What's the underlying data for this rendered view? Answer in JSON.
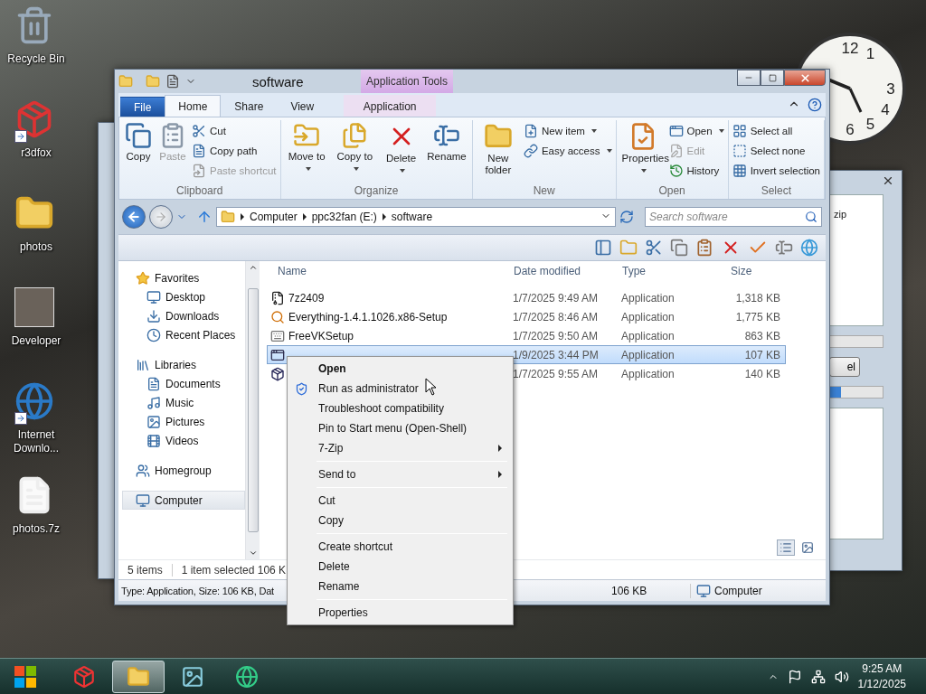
{
  "desktop_icons": [
    {
      "label": "Recycle Bin",
      "shortcut": false
    },
    {
      "label": "r3dfox",
      "shortcut": true
    },
    {
      "label": "photos",
      "shortcut": false
    },
    {
      "label": "Developer",
      "shortcut": false
    },
    {
      "label": "Internet Downlo...",
      "shortcut": true
    },
    {
      "label": "photos.7z",
      "shortcut": false
    }
  ],
  "clock": {
    "numerals": [
      "12",
      "1",
      "3",
      "4",
      "6",
      "5"
    ]
  },
  "back_window": {
    "list_text": "zip",
    "button": "el",
    "progress": [
      {
        "level": 0
      },
      {
        "level": 0.2
      }
    ]
  },
  "window": {
    "title": "software",
    "context_tab_header": "Application Tools"
  },
  "ribbon_tabs": [
    {
      "label": "File",
      "kind": "file",
      "selected": false
    },
    {
      "label": "Home",
      "kind": "tab",
      "selected": true
    },
    {
      "label": "Share",
      "kind": "tab",
      "selected": false
    },
    {
      "label": "View",
      "kind": "tab",
      "selected": false
    },
    {
      "label": "Application",
      "kind": "context",
      "selected": false
    }
  ],
  "ribbon_groups": [
    {
      "label": "Clipboard",
      "buttons": [
        {
          "label": "Copy",
          "kind": "large",
          "disabled": false,
          "dropdown": false
        },
        {
          "label": "Paste",
          "kind": "large",
          "disabled": true,
          "dropdown": false
        },
        {
          "label": "Cut",
          "kind": "small",
          "disabled": false,
          "dropdown": false
        },
        {
          "label": "Copy path",
          "kind": "small",
          "disabled": false,
          "dropdown": false
        },
        {
          "label": "Paste shortcut",
          "kind": "small",
          "disabled": true,
          "dropdown": false
        }
      ]
    },
    {
      "label": "Organize",
      "buttons": [
        {
          "label": "Move to",
          "kind": "large",
          "disabled": false,
          "dropdown": true
        },
        {
          "label": "Copy to",
          "kind": "large",
          "disabled": false,
          "dropdown": true
        },
        {
          "label": "Delete",
          "kind": "large",
          "disabled": false,
          "dropdown": true
        },
        {
          "label": "Rename",
          "kind": "large",
          "disabled": false,
          "dropdown": false
        }
      ]
    },
    {
      "label": "New",
      "buttons": [
        {
          "label": "New folder",
          "kind": "large",
          "disabled": false,
          "dropdown": false
        },
        {
          "label": "New item",
          "kind": "small",
          "disabled": false,
          "dropdown": true
        },
        {
          "label": "Easy access",
          "kind": "small",
          "disabled": false,
          "dropdown": true
        }
      ]
    },
    {
      "label": "Open",
      "buttons": [
        {
          "label": "Properties",
          "kind": "large",
          "disabled": false,
          "dropdown": true
        },
        {
          "label": "Open",
          "kind": "small",
          "disabled": false,
          "dropdown": true
        },
        {
          "label": "Edit",
          "kind": "small",
          "disabled": true,
          "dropdown": false
        },
        {
          "label": "History",
          "kind": "small",
          "disabled": false,
          "dropdown": false
        }
      ]
    },
    {
      "label": "Select",
      "buttons": [
        {
          "label": "Select all",
          "kind": "small",
          "disabled": false,
          "dropdown": false
        },
        {
          "label": "Select none",
          "kind": "small",
          "disabled": false,
          "dropdown": false
        },
        {
          "label": "Invert selection",
          "kind": "small",
          "disabled": false,
          "dropdown": false
        }
      ]
    }
  ],
  "address": {
    "crumbs": [
      "Computer",
      "ppc32fan (E:)",
      "software"
    ]
  },
  "search": {
    "placeholder": "Search software"
  },
  "navigation": [
    {
      "label": "Favorites",
      "selected": false,
      "children": [
        {
          "label": "Desktop",
          "selected": false
        },
        {
          "label": "Downloads",
          "selected": false
        },
        {
          "label": "Recent Places",
          "selected": false
        }
      ]
    },
    {
      "label": "Libraries",
      "selected": false,
      "children": [
        {
          "label": "Documents",
          "selected": false
        },
        {
          "label": "Music",
          "selected": false
        },
        {
          "label": "Pictures",
          "selected": false
        },
        {
          "label": "Videos",
          "selected": false
        }
      ]
    },
    {
      "label": "Homegroup",
      "selected": false
    },
    {
      "label": "Computer",
      "selected": true
    }
  ],
  "columns": [
    "Name",
    "Date modified",
    "Type",
    "Size"
  ],
  "files": [
    {
      "name": "7z2409",
      "date": "1/7/2025 9:49 AM",
      "type": "Application",
      "size": "1,318 KB",
      "selected": false
    },
    {
      "name": "Everything-1.4.1.1026.x86-Setup",
      "date": "1/7/2025 8:46 AM",
      "type": "Application",
      "size": "1,775 KB",
      "selected": false
    },
    {
      "name": "FreeVKSetup",
      "date": "1/7/2025 9:50 AM",
      "type": "Application",
      "size": "863 KB",
      "selected": false
    },
    {
      "date": "1/9/2025 3:44 PM",
      "type": "Application",
      "size": "107 KB",
      "selected": true
    },
    {
      "date": "1/7/2025 9:55 AM",
      "type": "Application",
      "size": "140 KB",
      "selected": false
    }
  ],
  "status_bar": {
    "count": "5 items",
    "selection": "1 item selected  106 K",
    "view_modes": [
      {
        "selected": true
      },
      {
        "selected": false
      }
    ]
  },
  "details_bar": {
    "details": "Type: Application, Size: 106 KB, Dat",
    "size": "106 KB",
    "location": "Computer"
  },
  "context_menu": [
    {
      "kind": "item",
      "label": "Open",
      "default": true,
      "submenu": false
    },
    {
      "kind": "item",
      "label": "Run as administrator",
      "default": false,
      "submenu": false
    },
    {
      "kind": "item",
      "label": "Troubleshoot compatibility",
      "default": false,
      "submenu": false
    },
    {
      "kind": "item",
      "label": "Pin to Start menu (Open-Shell)",
      "default": false,
      "submenu": false
    },
    {
      "kind": "item",
      "label": "7-Zip",
      "default": false,
      "submenu": true
    },
    {
      "kind": "separator"
    },
    {
      "kind": "item",
      "label": "Send to",
      "default": false,
      "submenu": true
    },
    {
      "kind": "separator"
    },
    {
      "kind": "item",
      "label": "Cut",
      "default": false,
      "submenu": false
    },
    {
      "kind": "item",
      "label": "Copy",
      "default": false,
      "submenu": false
    },
    {
      "kind": "separator"
    },
    {
      "kind": "item",
      "label": "Create shortcut",
      "default": false,
      "submenu": false
    },
    {
      "kind": "item",
      "label": "Delete",
      "default": false,
      "submenu": false
    },
    {
      "kind": "item",
      "label": "Rename",
      "default": false,
      "submenu": false
    },
    {
      "kind": "separator"
    },
    {
      "kind": "item",
      "label": "Properties",
      "default": false,
      "submenu": false
    }
  ],
  "taskbar": {
    "buttons": [
      {
        "selected": false
      },
      {
        "selected": true
      },
      {
        "selected": false
      },
      {
        "selected": false
      }
    ],
    "time": "9:25 AM",
    "date": "1/12/2025"
  }
}
